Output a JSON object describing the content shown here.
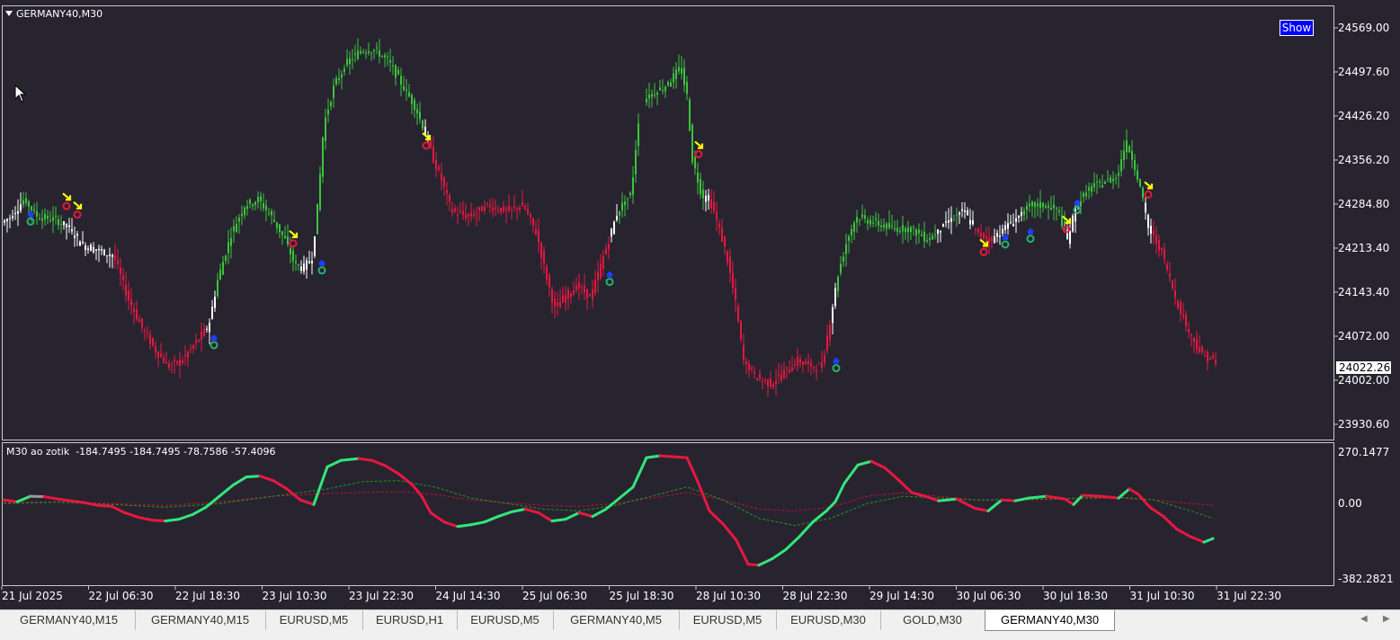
{
  "symbol_title": "GERMANY40,M30",
  "show_button": "Show",
  "indicator_label": "M30 ao zotik  -184.7495 -184.7495 -78.7586 -57.4096",
  "current_price": "24022.26",
  "price_axis_labels": [
    "24569.00",
    "24497.60",
    "24426.20",
    "24356.20",
    "24284.80",
    "24213.40",
    "24143.40",
    "24072.00",
    "24002.00",
    "23930.60"
  ],
  "indicator_axis_labels": [
    "270.1477",
    "0.00",
    "-382.2821"
  ],
  "time_axis_labels": [
    "21 Jul 2025",
    "22 Jul 06:30",
    "22 Jul 18:30",
    "23 Jul 10:30",
    "23 Jul 22:30",
    "24 Jul 14:30",
    "25 Jul 06:30",
    "25 Jul 18:30",
    "28 Jul 10:30",
    "28 Jul 22:30",
    "29 Jul 14:30",
    "30 Jul 06:30",
    "30 Jul 18:30",
    "31 Jul 10:30",
    "31 Jul 22:30"
  ],
  "tabs": [
    {
      "label": "GERMANY40,M15",
      "active": false
    },
    {
      "label": "GERMANY40,M15",
      "active": false
    },
    {
      "label": "EURUSD,M5",
      "active": false
    },
    {
      "label": "EURUSD,H1",
      "active": false
    },
    {
      "label": "EURUSD,M5",
      "active": false
    },
    {
      "label": "GERMANY40,M5",
      "active": false
    },
    {
      "label": "EURUSD,M5",
      "active": false
    },
    {
      "label": "EURUSD,M30",
      "active": false
    },
    {
      "label": "GOLD,M30",
      "active": false
    },
    {
      "label": "GERMANY40,M30",
      "active": true
    }
  ],
  "colors": {
    "bull": "#3cc43c",
    "bear": "#e8173f",
    "neutral": "#ffffff",
    "osc_up": "#33e67a",
    "osc_down": "#e8173f",
    "signal_green": "#1f9a1f",
    "signal_red": "#c01030"
  },
  "chart_data": {
    "type": "candlestick",
    "ylim": [
      23900,
      24600
    ],
    "osc_ylim": [
      -400,
      285
    ],
    "price_path": [
      [
        0,
        24260
      ],
      [
        10,
        24270
      ],
      [
        25,
        24300
      ],
      [
        40,
        24270
      ],
      [
        60,
        24265
      ],
      [
        75,
        24250
      ],
      [
        90,
        24220
      ],
      [
        110,
        24210
      ],
      [
        125,
        24200
      ],
      [
        140,
        24130
      ],
      [
        155,
        24080
      ],
      [
        170,
        24040
      ],
      [
        185,
        24010
      ],
      [
        200,
        24020
      ],
      [
        215,
        24050
      ],
      [
        230,
        24080
      ],
      [
        240,
        24160
      ],
      [
        255,
        24240
      ],
      [
        270,
        24290
      ],
      [
        285,
        24300
      ],
      [
        300,
        24270
      ],
      [
        315,
        24230
      ],
      [
        325,
        24190
      ],
      [
        335,
        24180
      ],
      [
        345,
        24200
      ],
      [
        352,
        24300
      ],
      [
        358,
        24430
      ],
      [
        370,
        24500
      ],
      [
        385,
        24540
      ],
      [
        400,
        24560
      ],
      [
        415,
        24560
      ],
      [
        430,
        24540
      ],
      [
        445,
        24500
      ],
      [
        460,
        24460
      ],
      [
        470,
        24420
      ],
      [
        480,
        24370
      ],
      [
        490,
        24330
      ],
      [
        500,
        24280
      ],
      [
        520,
        24270
      ],
      [
        540,
        24290
      ],
      [
        560,
        24280
      ],
      [
        580,
        24290
      ],
      [
        595,
        24240
      ],
      [
        605,
        24170
      ],
      [
        615,
        24110
      ],
      [
        625,
        24130
      ],
      [
        640,
        24150
      ],
      [
        655,
        24130
      ],
      [
        665,
        24180
      ],
      [
        675,
        24230
      ],
      [
        685,
        24280
      ],
      [
        700,
        24310
      ],
      [
        710,
        24470
      ],
      [
        720,
        24480
      ],
      [
        740,
        24500
      ],
      [
        755,
        24530
      ],
      [
        762,
        24480
      ],
      [
        768,
        24370
      ],
      [
        778,
        24310
      ],
      [
        790,
        24290
      ],
      [
        805,
        24210
      ],
      [
        815,
        24130
      ],
      [
        825,
        24020
      ],
      [
        840,
        23990
      ],
      [
        855,
        23980
      ],
      [
        870,
        24000
      ],
      [
        885,
        24020
      ],
      [
        900,
        24010
      ],
      [
        912,
        24010
      ],
      [
        920,
        24080
      ],
      [
        930,
        24170
      ],
      [
        940,
        24230
      ],
      [
        950,
        24270
      ],
      [
        970,
        24260
      ],
      [
        990,
        24250
      ],
      [
        1010,
        24250
      ],
      [
        1030,
        24230
      ],
      [
        1050,
        24260
      ],
      [
        1070,
        24280
      ],
      [
        1085,
        24240
      ],
      [
        1100,
        24230
      ],
      [
        1115,
        24250
      ],
      [
        1130,
        24270
      ],
      [
        1145,
        24290
      ],
      [
        1160,
        24290
      ],
      [
        1175,
        24280
      ],
      [
        1185,
        24230
      ],
      [
        1195,
        24290
      ],
      [
        1210,
        24320
      ],
      [
        1225,
        24330
      ],
      [
        1240,
        24340
      ],
      [
        1250,
        24400
      ],
      [
        1258,
        24370
      ],
      [
        1266,
        24320
      ],
      [
        1275,
        24250
      ],
      [
        1290,
        24210
      ],
      [
        1305,
        24130
      ],
      [
        1320,
        24070
      ],
      [
        1335,
        24030
      ],
      [
        1348,
        24020
      ]
    ],
    "osc_path": [
      [
        0,
        20
      ],
      [
        15,
        10
      ],
      [
        30,
        40
      ],
      [
        45,
        38
      ],
      [
        60,
        25
      ],
      [
        75,
        15
      ],
      [
        90,
        5
      ],
      [
        105,
        -10
      ],
      [
        120,
        -15
      ],
      [
        135,
        -50
      ],
      [
        150,
        -75
      ],
      [
        165,
        -90
      ],
      [
        180,
        -95
      ],
      [
        195,
        -85
      ],
      [
        210,
        -60
      ],
      [
        225,
        -20
      ],
      [
        240,
        40
      ],
      [
        255,
        100
      ],
      [
        270,
        145
      ],
      [
        285,
        150
      ],
      [
        300,
        125
      ],
      [
        315,
        80
      ],
      [
        330,
        20
      ],
      [
        345,
        -5
      ],
      [
        360,
        200
      ],
      [
        375,
        235
      ],
      [
        395,
        245
      ],
      [
        410,
        235
      ],
      [
        425,
        205
      ],
      [
        440,
        160
      ],
      [
        455,
        100
      ],
      [
        465,
        40
      ],
      [
        475,
        -50
      ],
      [
        490,
        -100
      ],
      [
        505,
        -125
      ],
      [
        520,
        -115
      ],
      [
        535,
        -100
      ],
      [
        550,
        -70
      ],
      [
        565,
        -45
      ],
      [
        580,
        -30
      ],
      [
        595,
        -50
      ],
      [
        610,
        -95
      ],
      [
        625,
        -85
      ],
      [
        640,
        -50
      ],
      [
        655,
        -70
      ],
      [
        670,
        -30
      ],
      [
        685,
        30
      ],
      [
        700,
        90
      ],
      [
        715,
        250
      ],
      [
        730,
        260
      ],
      [
        745,
        255
      ],
      [
        760,
        250
      ],
      [
        772,
        120
      ],
      [
        785,
        -40
      ],
      [
        800,
        -110
      ],
      [
        815,
        -200
      ],
      [
        828,
        -330
      ],
      [
        840,
        -335
      ],
      [
        855,
        -300
      ],
      [
        870,
        -250
      ],
      [
        885,
        -180
      ],
      [
        900,
        -100
      ],
      [
        915,
        -40
      ],
      [
        925,
        10
      ],
      [
        935,
        110
      ],
      [
        950,
        210
      ],
      [
        965,
        230
      ],
      [
        980,
        195
      ],
      [
        995,
        130
      ],
      [
        1010,
        60
      ],
      [
        1025,
        40
      ],
      [
        1040,
        15
      ],
      [
        1060,
        25
      ],
      [
        1080,
        -25
      ],
      [
        1095,
        -40
      ],
      [
        1110,
        20
      ],
      [
        1125,
        15
      ],
      [
        1140,
        30
      ],
      [
        1160,
        40
      ],
      [
        1180,
        25
      ],
      [
        1190,
        -5
      ],
      [
        1200,
        45
      ],
      [
        1220,
        40
      ],
      [
        1240,
        30
      ],
      [
        1252,
        80
      ],
      [
        1262,
        50
      ],
      [
        1275,
        -20
      ],
      [
        1290,
        -70
      ],
      [
        1305,
        -140
      ],
      [
        1320,
        -180
      ],
      [
        1335,
        -210
      ],
      [
        1345,
        -190
      ]
    ],
    "signal_green_path": [
      [
        0,
        0
      ],
      [
        60,
        8
      ],
      [
        120,
        -5
      ],
      [
        180,
        -20
      ],
      [
        240,
        0
      ],
      [
        300,
        40
      ],
      [
        360,
        80
      ],
      [
        400,
        120
      ],
      [
        440,
        125
      ],
      [
        480,
        90
      ],
      [
        520,
        30
      ],
      [
        560,
        0
      ],
      [
        600,
        -30
      ],
      [
        640,
        -40
      ],
      [
        680,
        -10
      ],
      [
        720,
        40
      ],
      [
        760,
        90
      ],
      [
        800,
        20
      ],
      [
        840,
        -80
      ],
      [
        880,
        -120
      ],
      [
        920,
        -80
      ],
      [
        960,
        0
      ],
      [
        1000,
        40
      ],
      [
        1040,
        30
      ],
      [
        1080,
        20
      ],
      [
        1120,
        20
      ],
      [
        1160,
        25
      ],
      [
        1200,
        30
      ],
      [
        1240,
        35
      ],
      [
        1280,
        20
      ],
      [
        1320,
        -40
      ],
      [
        1345,
        -80
      ]
    ],
    "signal_red_path": [
      [
        0,
        5
      ],
      [
        60,
        10
      ],
      [
        120,
        0
      ],
      [
        180,
        -10
      ],
      [
        240,
        10
      ],
      [
        300,
        40
      ],
      [
        360,
        55
      ],
      [
        400,
        60
      ],
      [
        440,
        65
      ],
      [
        480,
        50
      ],
      [
        520,
        20
      ],
      [
        560,
        5
      ],
      [
        600,
        -10
      ],
      [
        640,
        -15
      ],
      [
        680,
        0
      ],
      [
        720,
        30
      ],
      [
        760,
        60
      ],
      [
        800,
        20
      ],
      [
        840,
        -30
      ],
      [
        880,
        -40
      ],
      [
        920,
        -20
      ],
      [
        960,
        40
      ],
      [
        1000,
        60
      ],
      [
        1040,
        40
      ],
      [
        1080,
        20
      ],
      [
        1120,
        20
      ],
      [
        1160,
        22
      ],
      [
        1200,
        28
      ],
      [
        1240,
        30
      ],
      [
        1280,
        20
      ],
      [
        1320,
        0
      ],
      [
        1345,
        -10
      ]
    ],
    "sell_signals": [
      [
        70,
        24295
      ],
      [
        82,
        24280
      ],
      [
        322,
        24230
      ],
      [
        470,
        24400
      ],
      [
        773,
        24385
      ],
      [
        1090,
        24215
      ],
      [
        1182,
        24255
      ],
      [
        1273,
        24315
      ]
    ],
    "buy_signals": [
      [
        30,
        24265
      ],
      [
        234,
        24050
      ],
      [
        354,
        24180
      ],
      [
        674,
        24160
      ],
      [
        926,
        24010
      ],
      [
        1114,
        24225
      ],
      [
        1142,
        24235
      ],
      [
        1194,
        24285
      ]
    ]
  }
}
